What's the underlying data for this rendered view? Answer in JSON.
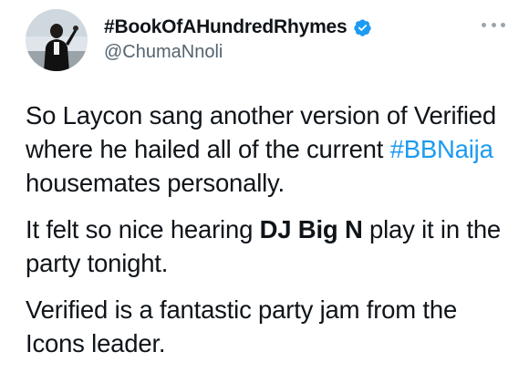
{
  "author": {
    "display_name": "#BookOfAHundredRhymes",
    "handle": "@ChumaNnoli",
    "verified": true,
    "verified_color": "#1d9bf0",
    "avatar_icon": "profile-photo"
  },
  "menu": {
    "icon": "more-horizontal-icon"
  },
  "tweet": {
    "p1": {
      "before": "So Laycon sang another version of Verified where he hailed all of the current ",
      "hashtag": "#BBNaija",
      "after": " housemates personally."
    },
    "p2": {
      "before": "It felt so nice hearing ",
      "bold": "DJ Big N",
      "after": " play it in the party tonight."
    },
    "p3": {
      "text": "Verified is a fantastic party jam from the Icons leader."
    }
  },
  "colors": {
    "text": "#0f1419",
    "secondary": "#536471",
    "link": "#1d9bf0"
  }
}
